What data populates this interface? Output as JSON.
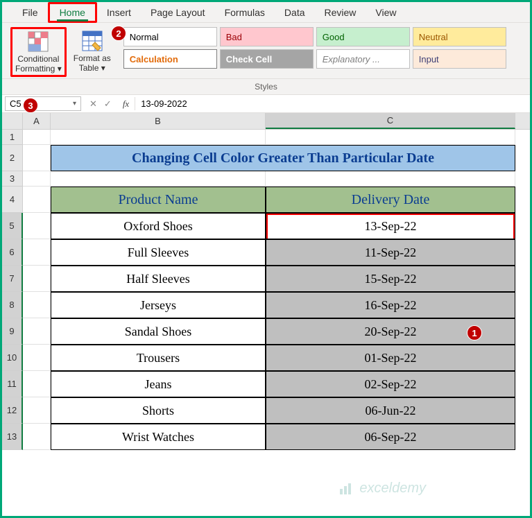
{
  "tabs": {
    "file": "File",
    "home": "Home",
    "insert": "Insert",
    "pagelayout": "Page Layout",
    "formulas": "Formulas",
    "data": "Data",
    "review": "Review",
    "view": "View"
  },
  "ribbon": {
    "cf_line1": "Conditional",
    "cf_line2": "Formatting",
    "fmt_line1": "Format as",
    "fmt_line2": "Table",
    "styles_label": "Styles",
    "swatches": {
      "normal": "Normal",
      "bad": "Bad",
      "good": "Good",
      "neutral": "Neutral",
      "calc": "Calculation",
      "check": "Check Cell",
      "exp": "Explanatory ...",
      "input": "Input"
    }
  },
  "formula_bar": {
    "name_box": "C5",
    "fx": "fx",
    "formula": "13-09-2022"
  },
  "grid": {
    "cols": {
      "A": "A",
      "B": "B",
      "C": "C"
    },
    "rows": [
      "1",
      "2",
      "3",
      "4",
      "5",
      "6",
      "7",
      "8",
      "9",
      "10",
      "11",
      "12",
      "13"
    ],
    "title": "Changing Cell Color Greater Than Particular Date",
    "header_b": "Product Name",
    "header_c": "Delivery Date",
    "data": [
      {
        "b": "Oxford Shoes",
        "c": "13-Sep-22",
        "gray": false
      },
      {
        "b": "Full Sleeves",
        "c": "11-Sep-22",
        "gray": true
      },
      {
        "b": "Half Sleeves",
        "c": "15-Sep-22",
        "gray": true
      },
      {
        "b": "Jerseys",
        "c": "16-Sep-22",
        "gray": true
      },
      {
        "b": "Sandal Shoes",
        "c": "20-Sep-22",
        "gray": true
      },
      {
        "b": "Trousers",
        "c": "01-Sep-22",
        "gray": true
      },
      {
        "b": "Jeans",
        "c": "02-Sep-22",
        "gray": true
      },
      {
        "b": "Shorts",
        "c": "06-Jun-22",
        "gray": true
      },
      {
        "b": "Wrist Watches",
        "c": "06-Sep-22",
        "gray": true
      }
    ]
  },
  "badges": {
    "b1": "1",
    "b2": "2",
    "b3": "3"
  },
  "watermark": "exceldemy"
}
